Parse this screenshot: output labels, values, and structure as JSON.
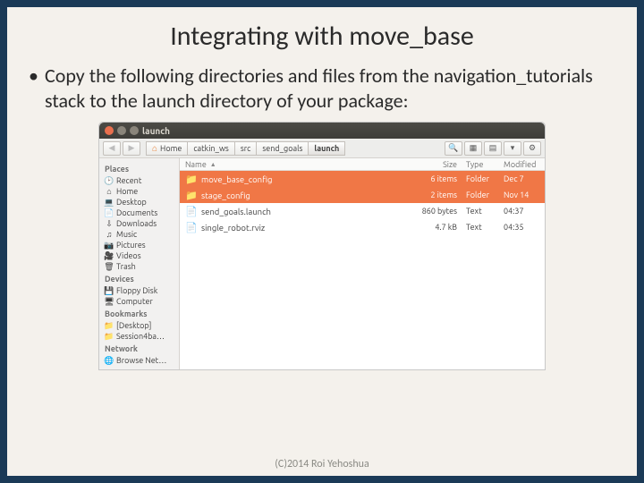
{
  "slide": {
    "title": "Integrating with move_base",
    "bullet": "Copy the following directories and files from the navigation_tutorials stack to the launch directory of your package:",
    "footer": "(C)2014 Roi Yehoshua"
  },
  "window": {
    "title": "launch"
  },
  "breadcrumbs": {
    "home": "Home",
    "b1": "catkin_ws",
    "b2": "src",
    "b3": "send_goals",
    "b4": "launch"
  },
  "sidebar": {
    "h1": "Places",
    "recent": "Recent",
    "home": "Home",
    "desktop": "Desktop",
    "documents": "Documents",
    "downloads": "Downloads",
    "music": "Music",
    "pictures": "Pictures",
    "videos": "Videos",
    "trash": "Trash",
    "h2": "Devices",
    "floppy": "Floppy Disk",
    "computer": "Computer",
    "h3": "Bookmarks",
    "bm1": "[Desktop]",
    "bm2": "Session4ba…",
    "h4": "Network",
    "net": "Browse Net…"
  },
  "columns": {
    "name": "Name",
    "size": "Size",
    "type": "Type",
    "modified": "Modified"
  },
  "files": {
    "r0": {
      "name": "move_base_config",
      "size": "6 items",
      "type": "Folder",
      "modified": "Dec 7"
    },
    "r1": {
      "name": "stage_config",
      "size": "2 items",
      "type": "Folder",
      "modified": "Nov 14"
    },
    "r2": {
      "name": "send_goals.launch",
      "size": "860 bytes",
      "type": "Text",
      "modified": "04:37"
    },
    "r3": {
      "name": "single_robot.rviz",
      "size": "4.7 kB",
      "type": "Text",
      "modified": "04:35"
    }
  }
}
